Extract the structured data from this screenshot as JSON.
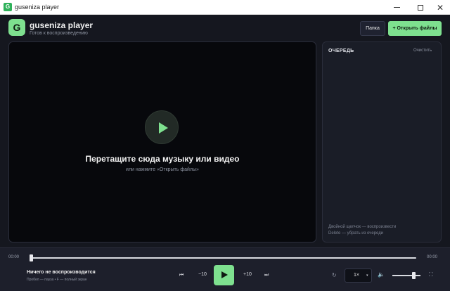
{
  "window": {
    "icon_letter": "G",
    "title": "guseniza player",
    "min": "",
    "max": "",
    "close": "✕"
  },
  "header": {
    "logo_letter": "G",
    "title": "guseniza player",
    "status": "Готов к воспроизведению",
    "folder_label": "Папка",
    "open_label": "+ Открыть файлы"
  },
  "dropzone": {
    "title": "Перетащите сюда музыку или видео",
    "subtitle": "или нажмите «Открыть файлы»"
  },
  "queue": {
    "title": "ОЧЕРЕДЬ",
    "clear_label": "Очистить",
    "hint_dblclick": "Двойной щелчок — воспроизвести",
    "hint_delete": "Delete — убрать из очереди"
  },
  "player": {
    "current_time": "00:00",
    "total_time": "00:00",
    "progress_fraction": 0,
    "now_playing": "Ничего не воспроизводится",
    "shortcuts_hint": "Пробел — пауза  •  F — полный экран",
    "prev_icon": "⏮",
    "back_label": "−10",
    "forward_label": "+10",
    "next_icon": "⏭",
    "repeat_icon": "↻",
    "speed_value": "1×",
    "speed_caret": "▾",
    "volume_icon": "🔈",
    "volume_fraction": 0.75,
    "fullscreen_icon": "⛶"
  },
  "colors": {
    "accent": "#7ee08f",
    "background": "#15171f",
    "panel": "#1a1d27"
  }
}
